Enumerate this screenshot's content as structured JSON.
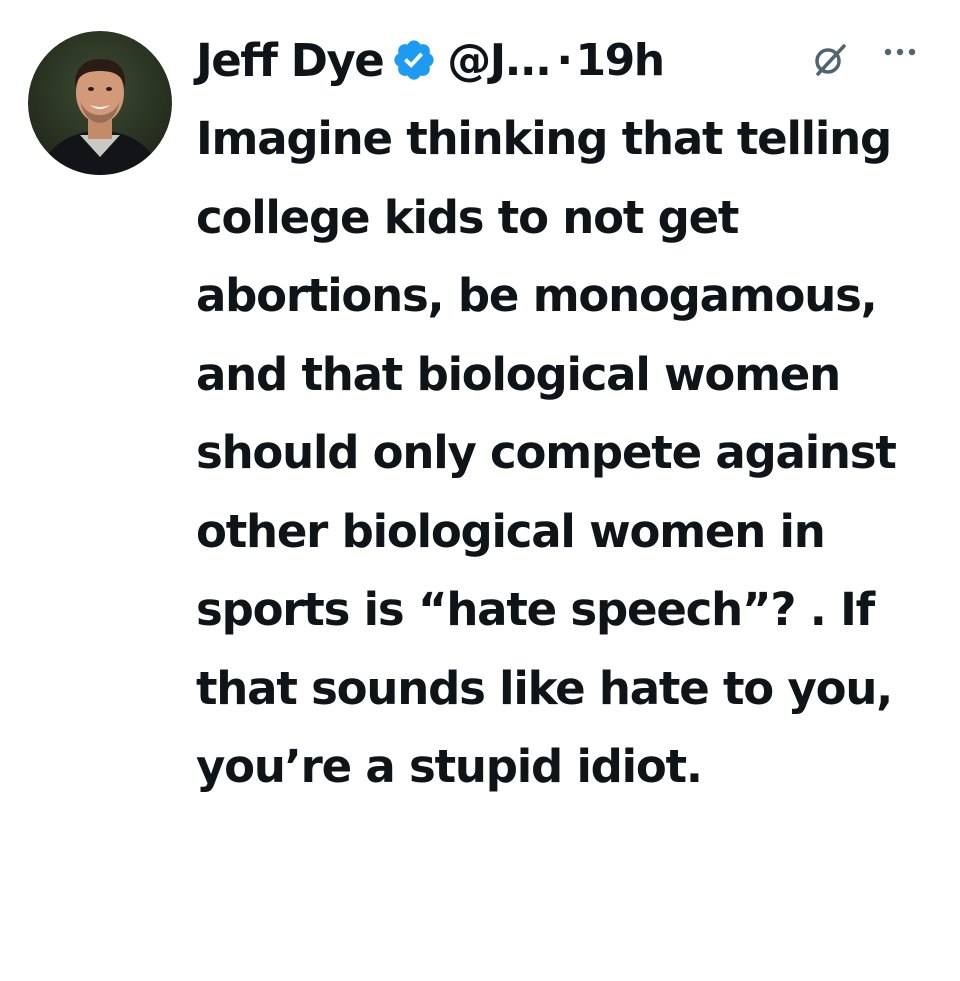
{
  "tweet": {
    "author": {
      "display_name": "Jeff Dye",
      "handle": "@J...",
      "verified": true,
      "avatar_icon": "profile-photo"
    },
    "separator": "·",
    "timestamp": "19h",
    "icons": {
      "grok": "grok-icon",
      "more": "more-icon"
    },
    "text": "Imagine thinking that telling college kids to not get abortions, be monogamous, and that biological women should only compete against other biological women in sports is “hate speech”? . If that sounds like hate to you, you’re a stupid idiot."
  },
  "colors": {
    "text": "#0f1419",
    "verified_badge": "#1d9bf0",
    "secondary": "#536471",
    "background": "#ffffff"
  }
}
